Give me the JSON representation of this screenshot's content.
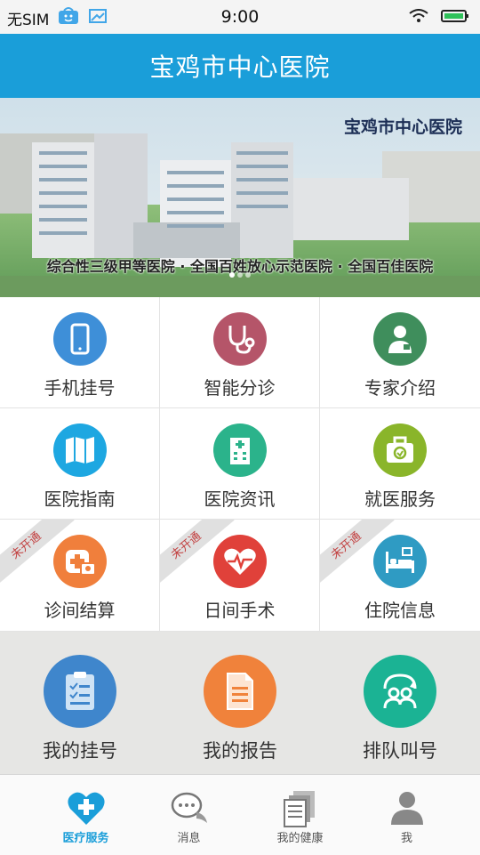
{
  "status_bar": {
    "carrier": "无SIM",
    "time": "9:00"
  },
  "header": {
    "title": "宝鸡市中心医院"
  },
  "banner": {
    "logo_text": "宝鸡市中心医院",
    "caption": "综合性三级甲等医院 · 全国百姓放心示范医院 · 全国百佳医院"
  },
  "grid": {
    "items": [
      {
        "label": "手机挂号",
        "icon": "phone-icon",
        "color": "#3e8fd8"
      },
      {
        "label": "智能分诊",
        "icon": "stethoscope-icon",
        "color": "#b55569"
      },
      {
        "label": "专家介绍",
        "icon": "doctor-icon",
        "color": "#3f8e5c"
      },
      {
        "label": "医院指南",
        "icon": "map-icon",
        "color": "#1ea7e1"
      },
      {
        "label": "医院资讯",
        "icon": "hospital-building-icon",
        "color": "#2bb38b"
      },
      {
        "label": "就医服务",
        "icon": "medical-kit-icon",
        "color": "#8ab52a"
      },
      {
        "label": "诊间结算",
        "icon": "medical-payment-icon",
        "color": "#f07f3c",
        "ribbon": "未开通"
      },
      {
        "label": "日间手术",
        "icon": "heart-pulse-icon",
        "color": "#e0413a",
        "ribbon": "未开通"
      },
      {
        "label": "住院信息",
        "icon": "hospital-bed-icon",
        "color": "#2f9bc3",
        "ribbon": "未开通"
      }
    ]
  },
  "quick": {
    "items": [
      {
        "label": "我的挂号",
        "icon": "clipboard-icon",
        "color": "#3f86cc"
      },
      {
        "label": "我的报告",
        "icon": "report-icon",
        "color": "#f0823b"
      },
      {
        "label": "排队叫号",
        "icon": "queue-icon",
        "color": "#1bb394"
      }
    ]
  },
  "tabbar": {
    "items": [
      {
        "label": "医疗服务",
        "icon": "heart-plus-icon"
      },
      {
        "label": "消息",
        "icon": "chat-icon"
      },
      {
        "label": "我的健康",
        "icon": "health-records-icon"
      },
      {
        "label": "我",
        "icon": "person-icon"
      }
    ],
    "active_index": 0,
    "active_color": "#1a9ed9"
  }
}
